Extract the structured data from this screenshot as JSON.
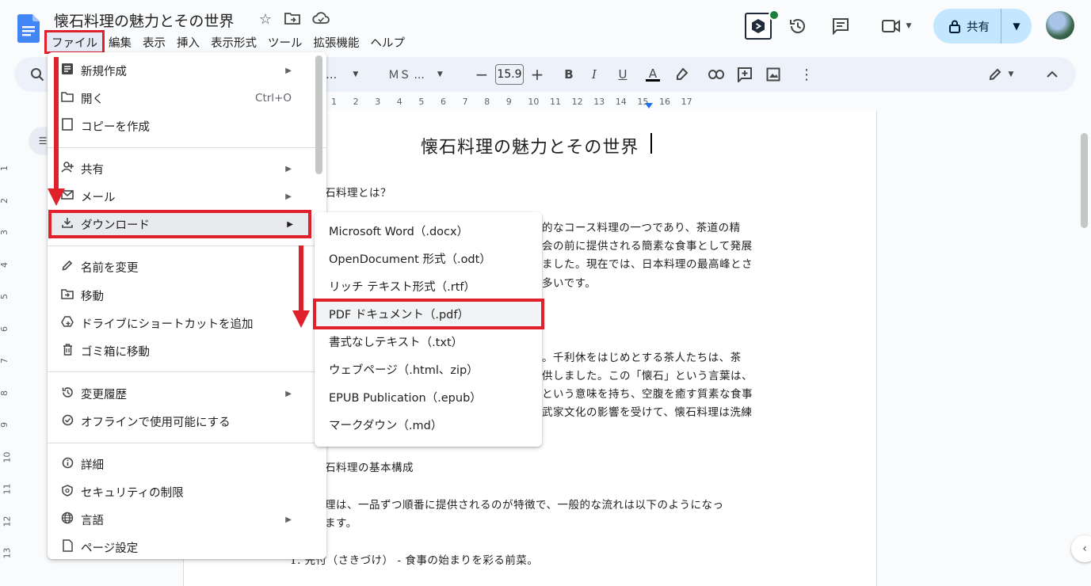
{
  "header": {
    "title": "懐石料理の魅力とその世界",
    "menus": [
      "ファイル",
      "編集",
      "表示",
      "挿入",
      "表示形式",
      "ツール",
      "拡張機能",
      "ヘルプ"
    ],
    "share_label": "共有"
  },
  "toolbar": {
    "style_label": "...",
    "font_label": "ＭＳ ...",
    "font_size": "15.9"
  },
  "ruler": {
    "ticks": [
      "1",
      "2",
      "3",
      "4",
      "5",
      "6",
      "7",
      "8",
      "9",
      "10",
      "11",
      "12",
      "13",
      "14",
      "15",
      "16",
      "17"
    ],
    "vticks": [
      "1",
      "2",
      "3",
      "4",
      "5",
      "6",
      "7",
      "8",
      "9",
      "10",
      "11",
      "12",
      "13"
    ]
  },
  "file_menu": {
    "items": [
      {
        "label": "新規作成",
        "icon": "document-icon",
        "arrow": true
      },
      {
        "label": "開く",
        "icon": "folder-icon",
        "shortcut": "Ctrl+O"
      },
      {
        "label": "コピーを作成",
        "icon": "copy-icon"
      },
      {
        "label": "共有",
        "icon": "person-add-icon",
        "arrow": true
      },
      {
        "label": "メール",
        "icon": "mail-icon",
        "arrow": true
      },
      {
        "label": "ダウンロード",
        "icon": "download-icon",
        "arrow": true
      },
      {
        "label": "名前を変更",
        "icon": "pencil-icon"
      },
      {
        "label": "移動",
        "icon": "folder-move-icon"
      },
      {
        "label": "ドライブにショートカットを追加",
        "icon": "drive-shortcut-icon"
      },
      {
        "label": "ゴミ箱に移動",
        "icon": "trash-icon"
      },
      {
        "label": "変更履歴",
        "icon": "history-icon",
        "arrow": true
      },
      {
        "label": "オフラインで使用可能にする",
        "icon": "offline-icon"
      },
      {
        "label": "詳細",
        "icon": "info-icon"
      },
      {
        "label": "セキュリティの制限",
        "icon": "security-icon"
      },
      {
        "label": "言語",
        "icon": "globe-icon",
        "arrow": true
      },
      {
        "label": "ページ設定",
        "icon": "page-icon"
      }
    ]
  },
  "download_submenu": {
    "items": [
      "Microsoft Word（.docx）",
      "OpenDocument 形式（.odt）",
      "リッチ テキスト形式（.rtf）",
      "PDF ドキュメント（.pdf）",
      "書式なしテキスト（.txt）",
      "ウェブページ（.html、zip）",
      "EPUB Publication（.epub）",
      "マークダウン（.md）"
    ]
  },
  "document": {
    "heading": "懐石料理の魅力とその世界",
    "lines": [
      "石料理とは？",
      "的なコース料理の一つであり、茶道の精",
      "会の前に提供される簡素な食事として発展",
      "ました。現在では、日本料理の最高峰とさ",
      "多いです。",
      "。千利休をはじめとする茶人たちは、茶",
      "供しました。この「懐石」という言葉は、",
      "という意味を持ち、空腹を癒す質素な食事",
      "武家文化の影響を受けて、懐石料理は洗練",
      "石料理の基本構成",
      "理は、一品ずつ順番に提供されるのが特徴で、一般的な流れは以下のようになっ",
      "ます。",
      "1.  先付（さきづけ）  -  食事の始まりを彩る前菜。"
    ]
  },
  "colors": {
    "accent_red": "#e0202a",
    "share_bg": "#c2e7ff",
    "toolbar_bg": "#edf2fa",
    "docs_blue": "#4285f4"
  }
}
